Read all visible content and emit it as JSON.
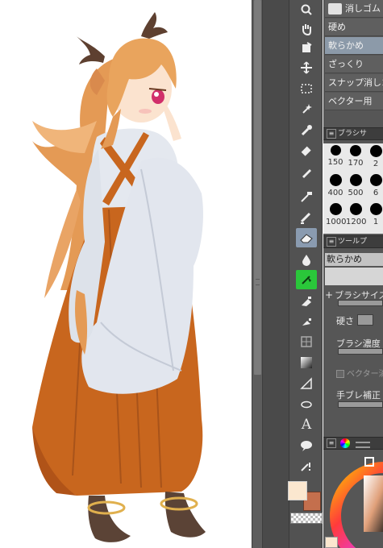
{
  "subtool_list": {
    "items": [
      {
        "label": "消しゴム",
        "selected": false,
        "has_icon": true
      },
      {
        "label": "硬め",
        "selected": false
      },
      {
        "label": "軟らかめ",
        "selected": true
      },
      {
        "label": "ざっくり",
        "selected": false
      },
      {
        "label": "スナップ消しゴム",
        "selected": false
      },
      {
        "label": "ベクター用",
        "selected": false
      }
    ]
  },
  "brush_size_panel": {
    "header": "ブラシサ",
    "sizes": [
      "150",
      "170",
      "2",
      "400",
      "500",
      "6",
      "1000",
      "1200",
      "1"
    ]
  },
  "tool_property": {
    "header": "ツールプ",
    "subtool_name": "軟らかめ",
    "brush_size_label": "ブラシサイズ",
    "hardness_label": "硬さ",
    "density_label": "ブラシ濃度",
    "vector_erase_label": "ベクター消",
    "stabilization_label": "手ブレ補正"
  },
  "colors": {
    "main": "#fbe7cf",
    "sub": "#c46f4d",
    "accent_selected": "#8c9aa9",
    "active_tool": "#2ac73a"
  },
  "tools": [
    "magnifier-icon",
    "hand-icon",
    "rotate-icon",
    "move-layer-icon",
    "selection-icon",
    "auto-select-icon",
    "eyedropper-icon",
    "pen-icon",
    "pencil-icon",
    "brush-icon",
    "airbrush-icon",
    "eraser-icon",
    "blend-icon",
    "fill-icon",
    "gradient-icon",
    "figure-icon",
    "frame-icon",
    "ruler-icon",
    "text-icon",
    "balloon-icon",
    "correct-line-icon"
  ]
}
